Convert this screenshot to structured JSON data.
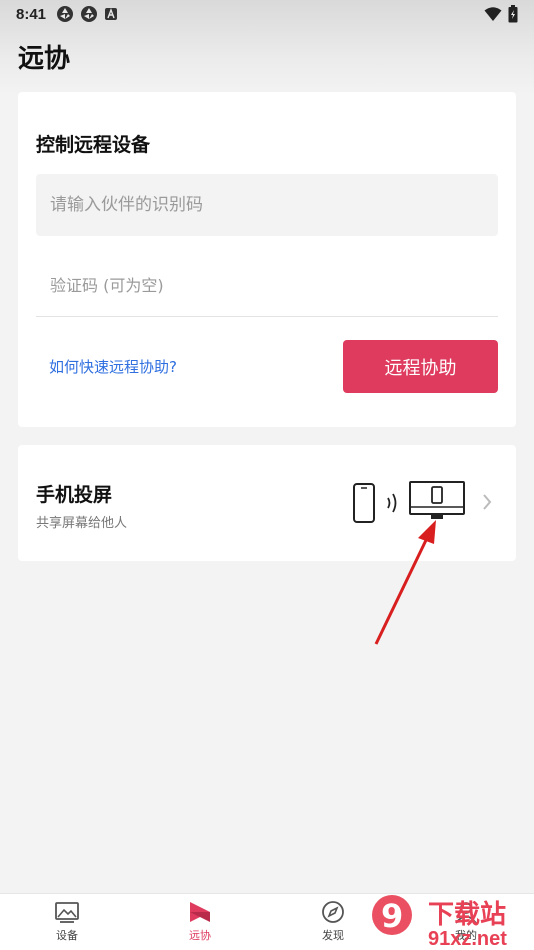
{
  "status_bar": {
    "time": "8:41",
    "left_icons": [
      "aperture-icon",
      "aperture-icon",
      "a-notification-icon"
    ],
    "right_icons": [
      "wifi-icon",
      "battery-icon"
    ]
  },
  "header": {
    "title": "远协"
  },
  "remote_card": {
    "title": "控制远程设备",
    "partner_id_placeholder": "请输入伙伴的识别码",
    "verification_placeholder": "验证码 (可为空)",
    "help_link": "如何快速远程协助?",
    "submit_label": "远程协助"
  },
  "cast_card": {
    "title": "手机投屏",
    "subtitle": "共享屏幕给他人",
    "icons": [
      "phone-icon",
      "signal-waves-icon",
      "monitor-icon",
      "chevron-right-icon"
    ]
  },
  "bottom_nav": {
    "items": [
      {
        "label": "设备",
        "icon": "image-frame-icon"
      },
      {
        "label": "远协",
        "icon": "remote-flag-icon",
        "active": true
      },
      {
        "label": "发现",
        "icon": "compass-icon"
      },
      {
        "label": "我的",
        "icon": "person-icon"
      }
    ]
  },
  "watermark": {
    "brand": "下载站",
    "site": "91xz.net",
    "logo": "9"
  },
  "colors": {
    "accent": "#de3b5e",
    "link": "#2f6fe0",
    "annotation_arrow": "#d81e1e"
  }
}
